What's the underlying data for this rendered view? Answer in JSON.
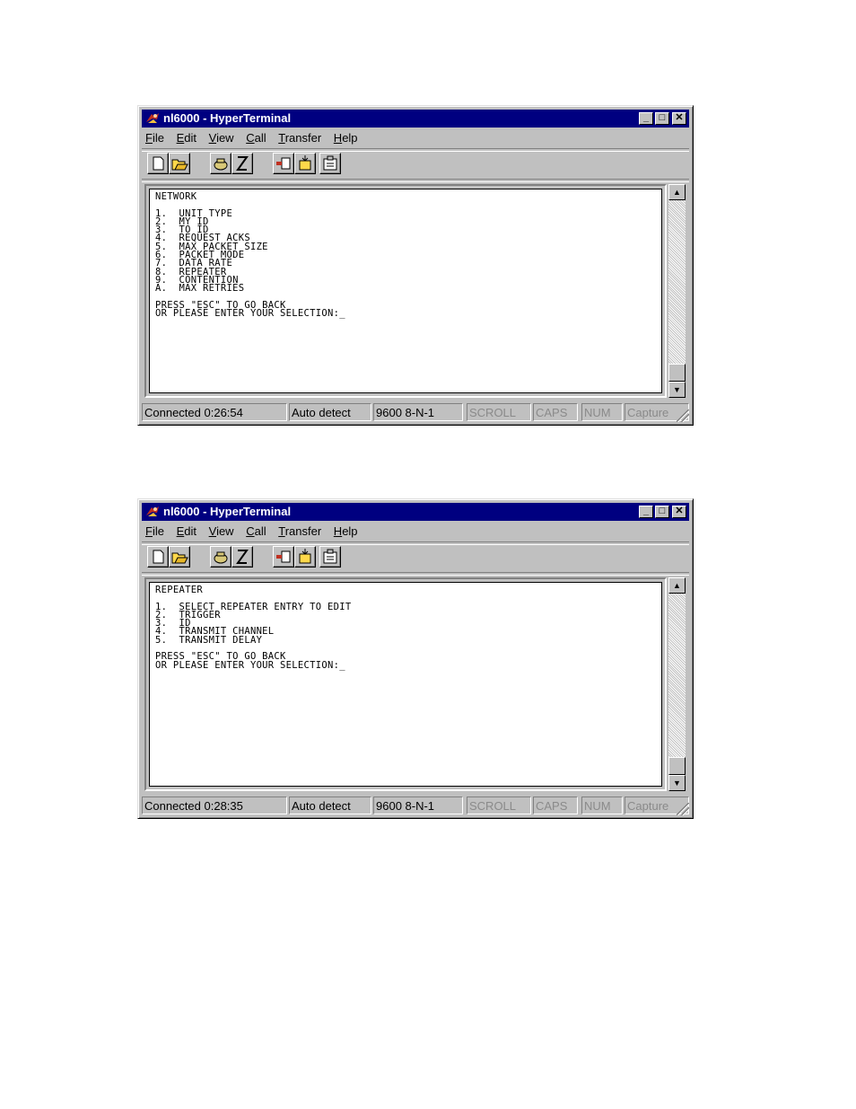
{
  "windows": [
    {
      "title": "nl6000 - HyperTerminal",
      "menu": [
        "File",
        "Edit",
        "View",
        "Call",
        "Transfer",
        "Help"
      ],
      "terminal_text": "NETWORK\n\n1.  UNIT TYPE\n2.  MY ID\n3.  TO ID\n4.  REQUEST ACKS\n5.  MAX PACKET SIZE\n6.  PACKET MODE\n7.  DATA RATE\n8.  REPEATER\n9.  CONTENTION\nA.  MAX RETRIES\n\nPRESS \"ESC\" TO GO BACK\nOR PLEASE ENTER YOUR SELECTION:_",
      "status": {
        "connected": "Connected 0:26:54",
        "detect": "Auto detect",
        "settings": "9600 8-N-1",
        "scroll": "SCROLL",
        "caps": "CAPS",
        "num": "NUM",
        "capture": "Capture"
      }
    },
    {
      "title": "nl6000 - HyperTerminal",
      "menu": [
        "File",
        "Edit",
        "View",
        "Call",
        "Transfer",
        "Help"
      ],
      "terminal_text": "REPEATER\n\n1.  SELECT REPEATER ENTRY TO EDIT\n2.  TRIGGER\n3.  ID\n4.  TRANSMIT CHANNEL\n5.  TRANSMIT DELAY\n\nPRESS \"ESC\" TO GO BACK\nOR PLEASE ENTER YOUR SELECTION:_",
      "status": {
        "connected": "Connected 0:28:35",
        "detect": "Auto detect",
        "settings": "9600 8-N-1",
        "scroll": "SCROLL",
        "caps": "CAPS",
        "num": "NUM",
        "capture": "Capture"
      }
    }
  ],
  "icons": {
    "app": "hyperterminal-icon",
    "toolbar": [
      "new-icon",
      "open-icon",
      "connect-icon",
      "disconnect-icon",
      "send-icon",
      "receive-icon",
      "properties-icon"
    ],
    "window_controls": [
      "minimize-icon",
      "maximize-icon",
      "close-icon"
    ]
  },
  "colors": {
    "titlebar": "#000080",
    "chrome": "#c0c0c0"
  }
}
